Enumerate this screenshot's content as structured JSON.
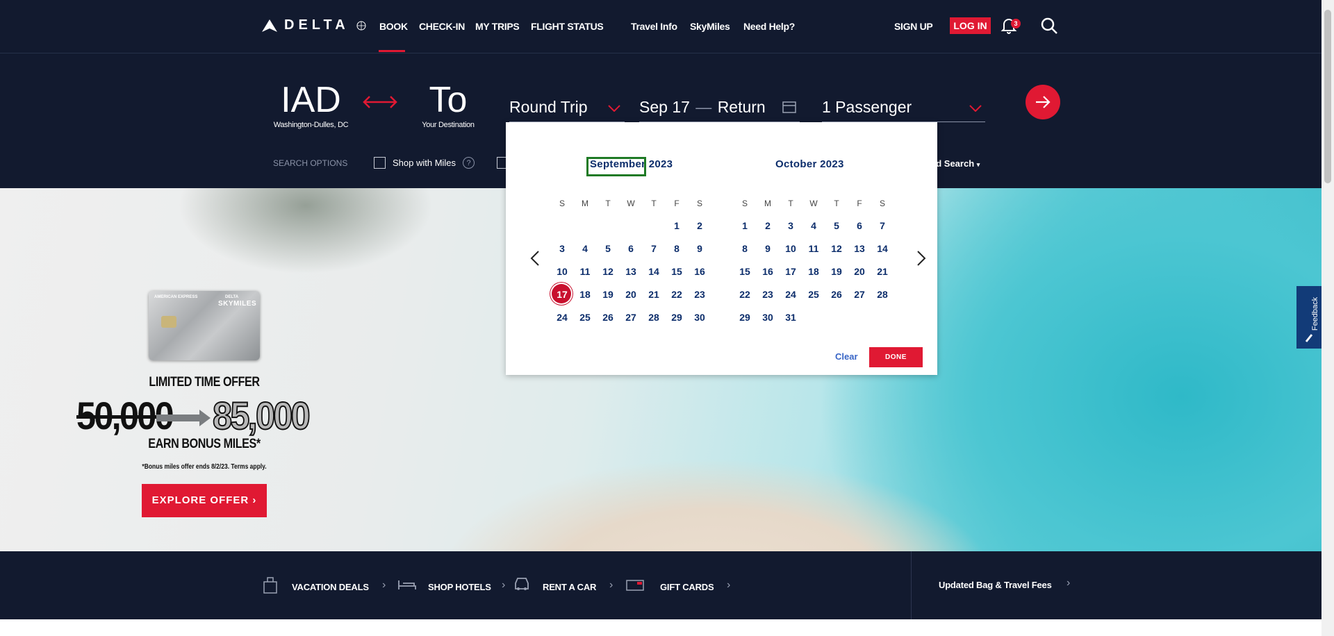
{
  "nav": {
    "logo_text": "DELTA",
    "primary": [
      "BOOK",
      "CHECK-IN",
      "MY TRIPS",
      "FLIGHT STATUS"
    ],
    "secondary": [
      "Travel Info",
      "SkyMiles",
      "Need Help?"
    ],
    "sign_up": "SIGN UP",
    "log_in": "LOG IN",
    "notification_count": "3"
  },
  "booking": {
    "origin_code": "IAD",
    "origin_name": "Washington-Dulles, DC",
    "destination_code": "To",
    "destination_name": "Your Destination",
    "trip_type": "Round Trip",
    "depart_date": "Sep 17",
    "date_separator": "—",
    "return_label": "Return",
    "passengers": "1 Passenger",
    "search_options_label": "SEARCH OPTIONS",
    "shop_with_miles": "Shop with Miles",
    "advanced_search": "ed Search"
  },
  "calendar": {
    "month1_name": "September",
    "month1_year": "2023",
    "month2_name": "October",
    "month2_year": "2023",
    "weekdays": [
      "S",
      "M",
      "T",
      "W",
      "T",
      "F",
      "S"
    ],
    "month1_start_weekday": 5,
    "month1_days": 30,
    "month2_start_weekday": 0,
    "month2_days": 31,
    "selected_day": 17,
    "clear_label": "Clear",
    "done_label": "DONE"
  },
  "promo": {
    "card_issuer": "AMERICAN EXPRESS",
    "card_brand": "DELTA",
    "card_product": "SKYMILES",
    "title": "LIMITED TIME OFFER",
    "old_miles": "50,000",
    "new_miles": "85,000",
    "subtitle": "EARN BONUS MILES*",
    "disclaimer": "*Bonus miles offer ends 8/2/23. Terms apply.",
    "cta": "EXPLORE OFFER"
  },
  "feedback": "Feedback",
  "bottom": {
    "items": [
      "VACATION DEALS",
      "SHOP HOTELS",
      "RENT A CAR",
      "GIFT CARDS"
    ],
    "fees_link": "Updated Bag & Travel Fees"
  },
  "colors": {
    "navy": "#121a2f",
    "red": "#e01933",
    "calendar_text": "#0c2d6b",
    "focus_green": "#1e7a25"
  }
}
